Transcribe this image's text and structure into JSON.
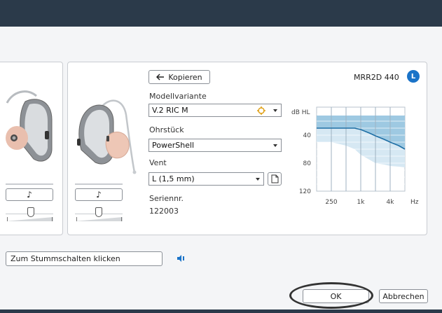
{
  "dialog": {
    "mute_button_label": "Zum Stummschalten klicken",
    "ok_label": "OK",
    "cancel_label": "Abbrechen"
  },
  "left_panel": {
    "music_glyph": "♪"
  },
  "right_panel": {
    "music_glyph": "♪",
    "copy_label": "Kopieren",
    "model_id": "MRR2D 440",
    "side_badge": "L",
    "model_variant_label": "Modellvariante",
    "model_variant_value": "V.2 RIC M",
    "earpiece_label": "Ohrstück",
    "earpiece_value": "PowerShell",
    "vent_label": "Vent",
    "vent_value": "L  (1,5 mm)",
    "serial_label": "Seriennr.",
    "serial_value": "122003"
  },
  "colors": {
    "accent_blue": "#1a73c8",
    "chart_fill_dark": "#9ec9e2",
    "chart_fill_light": "#d6e8f3",
    "chart_line": "#1f6fa5",
    "topbar": "#2b3a4a"
  },
  "chart_data": {
    "type": "line",
    "ylabel": "dB HL",
    "xlabel": "Hz",
    "y_ticks": [
      "40",
      "80",
      "120"
    ],
    "x_tick_labels": [
      "250",
      "1k",
      "4k"
    ],
    "ylim": [
      0,
      120
    ],
    "y_inverted": true,
    "x_log": true,
    "series": [
      {
        "x": [
          125,
          250,
          500,
          750,
          1000,
          1500,
          2000,
          3000,
          4000,
          6000,
          8000
        ],
        "values": [
          30,
          30,
          30,
          30,
          32,
          37,
          41,
          46,
          50,
          55,
          60
        ]
      }
    ],
    "fitting_range_upper": [
      12,
      12,
      12,
      12,
      12,
      12,
      12,
      12,
      12,
      12,
      12
    ],
    "fitting_range_lower": [
      50,
      50,
      55,
      60,
      68,
      75,
      80,
      82,
      84,
      85,
      86
    ]
  }
}
